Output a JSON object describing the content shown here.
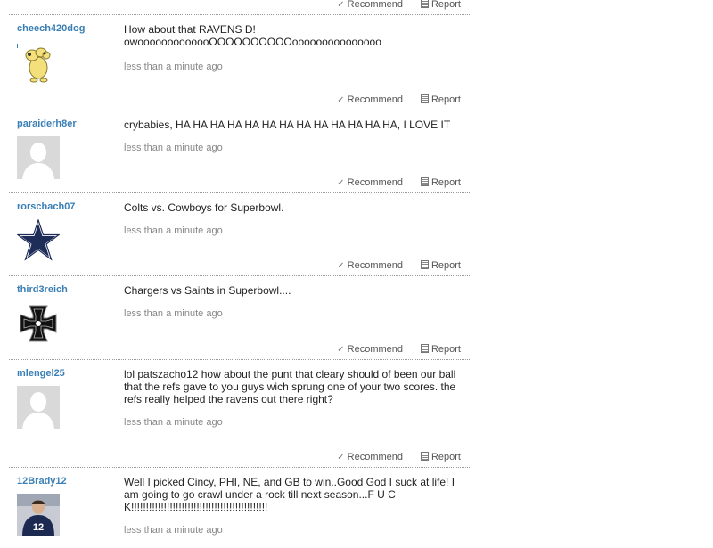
{
  "actions": {
    "recommend_label": "Recommend",
    "report_label": "Report"
  },
  "comments": [
    {
      "username": "cheech420dog",
      "text": "How about that RAVENS D! owooooooooooooOOOOOOOOOOooooooooooooooo",
      "time": "less than a minute ago",
      "avatar": "cartoon-dog-icon"
    },
    {
      "username": "paraiderh8er",
      "text": "crybabies, HA HA HA HA HA HA HA HA HA HA HA HA HA, I LOVE IT",
      "time": "less than a minute ago",
      "avatar": "default-user-silhouette"
    },
    {
      "username": "rorschach07",
      "text": "Colts vs. Cowboys for Superbowl.",
      "time": "less than a minute ago",
      "avatar": "dallas-star-icon"
    },
    {
      "username": "third3reich",
      "text": "Chargers vs Saints in Superbowl....",
      "time": "less than a minute ago",
      "avatar": "iron-cross-icon"
    },
    {
      "username": "mlengel25",
      "text": "lol patszacho12 how about the punt that cleary should of been our ball that the refs gave to you guys wich sprung one of your two scores. the refs really helped the ravens out there right?",
      "time": "less than a minute ago",
      "avatar": "default-user-silhouette"
    },
    {
      "username": "12Brady12",
      "text": "Well I picked Cincy, PHI, NE, and GB to win..Good God I suck at life! I am going to go crawl under a rock till next season...F U C K!!!!!!!!!!!!!!!!!!!!!!!!!!!!!!!!!!!!!!!!!!!!!!",
      "time": "less than a minute ago",
      "avatar": "football-player-photo"
    }
  ]
}
